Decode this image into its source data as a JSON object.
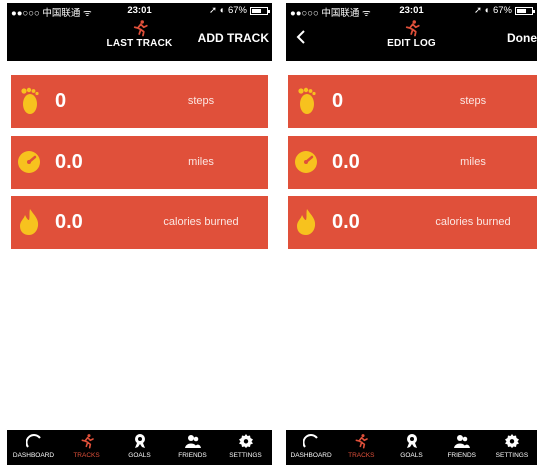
{
  "status_bar": {
    "carrier": "●●○○○ 中国联通 ᯤ",
    "time": "23:01",
    "battery_text": "➚ ◐ 67%",
    "battery_level": 0.67
  },
  "screen_left": {
    "title": "LAST TRACK",
    "action": "ADD TRACK",
    "stats": [
      {
        "icon": "footprint-icon",
        "value": "0",
        "label": "steps"
      },
      {
        "icon": "speedometer-icon",
        "value": "0.0",
        "label": "miles"
      },
      {
        "icon": "flame-icon",
        "value": "0.0",
        "label": "calories burned"
      }
    ]
  },
  "screen_right": {
    "title": "EDIT LOG",
    "action": "Done",
    "stats": [
      {
        "icon": "footprint-icon",
        "value": "0",
        "label": "steps"
      },
      {
        "icon": "speedometer-icon",
        "value": "0.0",
        "label": "miles"
      },
      {
        "icon": "flame-icon",
        "value": "0.0",
        "label": "calories burned"
      }
    ]
  },
  "tabs": [
    {
      "icon": "dashboard-gauge-icon",
      "label": "DASHBOARD"
    },
    {
      "icon": "runner-icon",
      "label": "TRACKS",
      "active": true
    },
    {
      "icon": "goals-medal-icon",
      "label": "GOALS"
    },
    {
      "icon": "friends-icon",
      "label": "FRIENDS"
    },
    {
      "icon": "settings-gear-icon",
      "label": "SETTINGS"
    }
  ],
  "colors": {
    "accent": "#e0503a",
    "bar": "#000000",
    "background": "#ffffff"
  }
}
